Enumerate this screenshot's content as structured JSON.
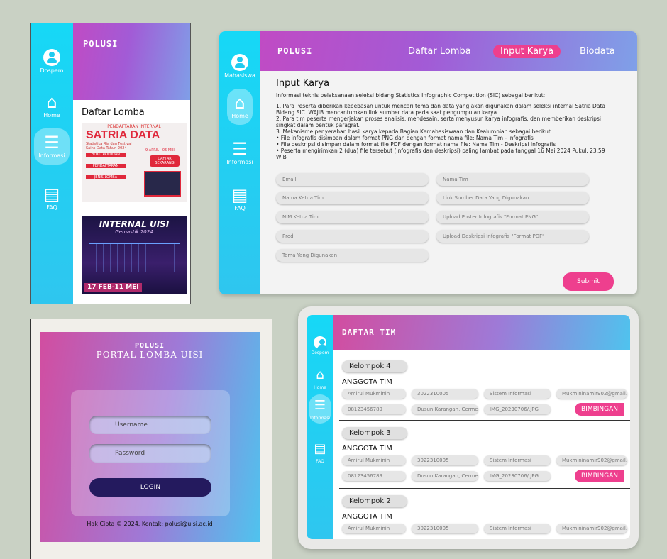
{
  "app": {
    "title": "POLUSI"
  },
  "panel1": {
    "sidebar": [
      {
        "label": "Dospem",
        "icon": "user-icon"
      },
      {
        "label": "Home",
        "icon": "home-icon"
      },
      {
        "label": "Informasi",
        "icon": "info-icon"
      },
      {
        "label": "FAQ",
        "icon": "chat-icon"
      }
    ],
    "section_title": "Daftar Lomba",
    "poster1": {
      "top": "PENDAFTARAN INTERNAL",
      "title": "SATRIA DATA",
      "desc": "Statistika Ria dan Festival Sains Data Tahun 2024",
      "buku": "BUKU PANDUAN",
      "daftar": "DAFTAR SEKARANG",
      "pendaftaran": "PENDAFTARAN",
      "jenis": "JENIS LOMBA",
      "dates": "9 APRIL - 05 MEI"
    },
    "poster2": {
      "title": "INTERNAL UISI",
      "subtitle": "Gemastik 2024",
      "dates": "17 FEB-11 MEI"
    }
  },
  "panel2": {
    "sidebar": [
      {
        "label": "Mahasiswa",
        "icon": "user-icon"
      },
      {
        "label": "Home",
        "icon": "home-icon"
      },
      {
        "label": "Informasi",
        "icon": "info-icon"
      },
      {
        "label": "FAQ",
        "icon": "chat-icon"
      }
    ],
    "nav": [
      {
        "label": "Daftar Lomba"
      },
      {
        "label": "Input Karya"
      },
      {
        "label": "Biodata"
      }
    ],
    "heading": "Input Karya",
    "intro": "Informasi teknis pelaksanaan seleksi bidang Statistics Infographic Competition (SIC) sebagai berikut:",
    "rules": [
      "1. Para Peserta diberikan kebebasan untuk mencari tema dan data yang akan digunakan dalam seleksi internal Satria Data Bidang SIC. WAJIB mencantumkan link sumber data pada saat pengumpulan karya.",
      "2. Para tim peserta mengerjakan proses analisis, mendesain, serta menyusun karya infografis, dan memberikan deskripsi singkat dalam bentuk paragraf.",
      "3. Mekanisme penyerahan hasil karya kepada Bagian Kemahasiswaan dan Kealumnian sebagai berikut:",
      "• File infografis disimpan dalam format PNG dan dengan format nama file: Nama Tim - Infografis",
      "• File deskripsi disimpan dalam format file PDF dengan format nama file: Nama Tim - Deskripsi Infografis",
      "• Peserta mengirimkan 2 (dua) file tersebut (infografis dan deskripsi) paling lambat pada tanggal 16 Mei 2024 Pukul. 23.59 WIB"
    ],
    "fields_left": [
      "Email",
      "Nama Ketua Tim",
      "NIM Ketua Tim",
      "Prodi",
      "Tema Yang Digunakan"
    ],
    "fields_right": [
      "Nama Tim",
      "Link Sumber Data Yang Digunakan",
      "Upload Poster Infografis \"Format PNG\"",
      "Upload Deskripsi Infografis \"Format PDF\""
    ],
    "submit": "Submit"
  },
  "panel3": {
    "title": "POLUSI",
    "subtitle": "PORTAL LOMBA UISI",
    "username_placeholder": "Username",
    "password_placeholder": "Password",
    "login": "LOGIN",
    "footer": "Hak Cipta © 2024. Kontak: polusi@uisi.ac.id"
  },
  "panel4": {
    "sidebar": [
      {
        "label": "Dospem",
        "icon": "user-icon"
      },
      {
        "label": "Home",
        "icon": "home-icon"
      },
      {
        "label": "Informasi",
        "icon": "info-icon"
      },
      {
        "label": "FAQ",
        "icon": "chat-icon"
      }
    ],
    "header": "DAFTAR TIM",
    "anggota_label": "ANGGOTA TIM",
    "bimbingan": "BIMBINGAN",
    "groups": [
      {
        "name": "Kelompok 4",
        "row1": [
          "Amirul Mukminin",
          "3022310005",
          "Sistem Informasi",
          "Mukmininamir902@gmail."
        ],
        "row2": [
          "08123456789",
          "Dusun Karangan, Cerme",
          "IMG_20230706/.JPG"
        ]
      },
      {
        "name": "Kelompok 3",
        "row1": [
          "Amirul Mukminin",
          "3022310005",
          "Sistem Informasi",
          "Mukmininamir902@gmail."
        ],
        "row2": [
          "08123456789",
          "Dusun Karangan, Cerme",
          "IMG_20230706/.JPG"
        ]
      },
      {
        "name": "Kelompok 2",
        "row1": [
          "Amirul Mukminin",
          "3022310005",
          "Sistem Informasi",
          "Mukmininamir902@gmail."
        ]
      }
    ]
  },
  "colors": {
    "cyan": "#16d8f6",
    "pink": "#ee3f8e",
    "purple": "#a25bd6",
    "navy": "#241a5e"
  }
}
